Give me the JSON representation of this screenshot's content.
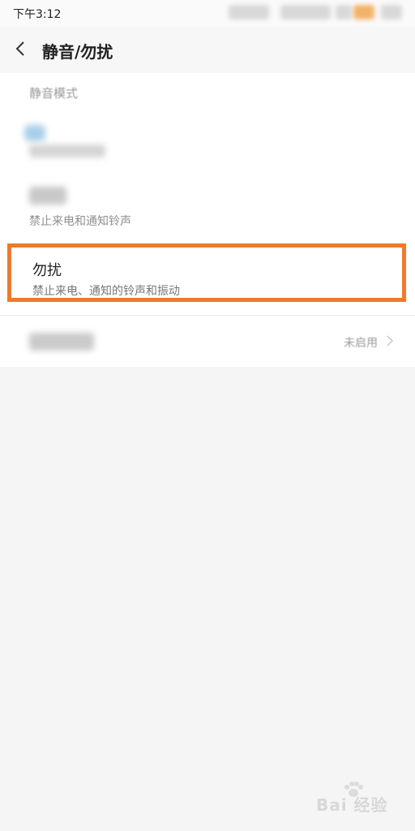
{
  "status_bar": {
    "time": "下午3:12"
  },
  "header": {
    "title": "静音/勿扰"
  },
  "section": {
    "label": "静音模式"
  },
  "silent_row": {
    "subtitle": "禁止来电和通知铃声"
  },
  "dnd_row": {
    "title": "勿扰",
    "subtitle": "禁止来电、通知的铃声和振动"
  },
  "schedule_row": {
    "value": "未启用"
  },
  "watermark": {
    "text": "Bai 经验"
  },
  "colors": {
    "highlight": "#ee7a2c",
    "background": "#f5f5f5"
  }
}
